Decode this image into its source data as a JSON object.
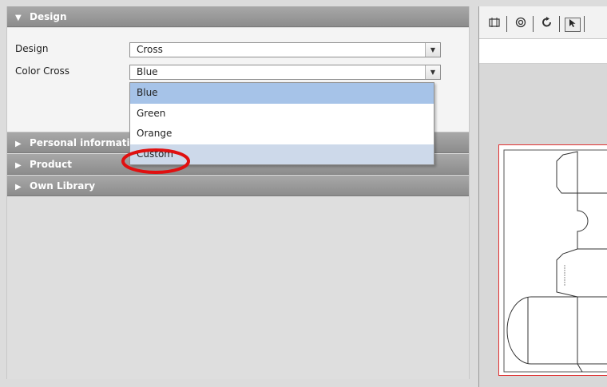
{
  "left_panel": {
    "sections": [
      {
        "label": "Design",
        "expanded": true
      },
      {
        "label": "Personal informatio",
        "expanded": false
      },
      {
        "label": "Product",
        "expanded": false
      },
      {
        "label": "Own Library",
        "expanded": false
      }
    ],
    "design_form": {
      "design_label": "Design",
      "design_value": "Cross",
      "color_label": "Color Cross",
      "color_value": "Blue"
    },
    "dropdown": {
      "options": [
        "Blue",
        "Green",
        "Orange",
        "Custom"
      ],
      "selected": "Blue",
      "hovered": "Custom"
    }
  },
  "colors": {
    "header_gray": "#969696",
    "selected_blue": "#a6c3e8",
    "hover_blue": "#cdd9ea",
    "annotation_red": "#e01010",
    "artboard_border": "#e03030"
  },
  "toolbar": {
    "icons": [
      "frame-icon",
      "target-icon",
      "rotate-icon",
      "pointer-icon"
    ]
  }
}
